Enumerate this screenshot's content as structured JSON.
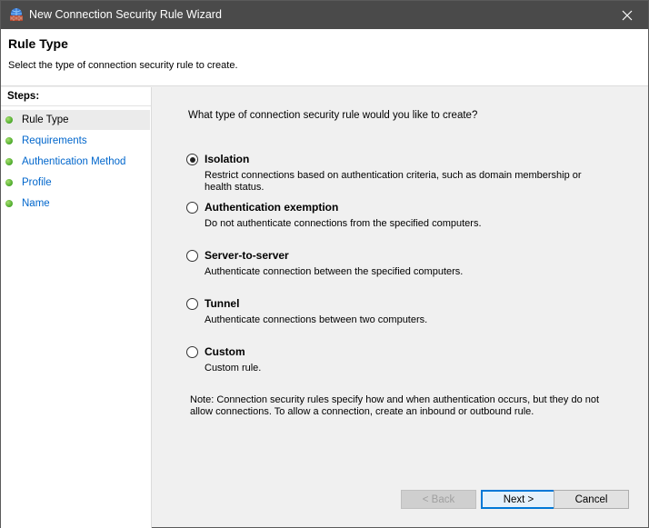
{
  "window": {
    "title": "New Connection Security Rule Wizard"
  },
  "header": {
    "title": "Rule Type",
    "subtitle": "Select the type of connection security rule to create."
  },
  "sidebar": {
    "title": "Steps:",
    "items": [
      {
        "label": "Rule Type",
        "current": true
      },
      {
        "label": "Requirements",
        "current": false
      },
      {
        "label": "Authentication Method",
        "current": false
      },
      {
        "label": "Profile",
        "current": false
      },
      {
        "label": "Name",
        "current": false
      }
    ]
  },
  "main": {
    "question": "What type of connection security rule would you like to create?",
    "options": [
      {
        "label": "Isolation",
        "description": "Restrict connections based on authentication criteria, such as domain membership or health status.",
        "selected": true
      },
      {
        "label": "Authentication exemption",
        "description": "Do not authenticate connections from the specified computers.",
        "selected": false
      },
      {
        "label": "Server-to-server",
        "description": "Authenticate connection between the specified computers.",
        "selected": false
      },
      {
        "label": "Tunnel",
        "description": "Authenticate connections between two computers.",
        "selected": false
      },
      {
        "label": "Custom",
        "description": "Custom rule.",
        "selected": false
      }
    ],
    "note": "Note:  Connection security rules specify how and when authentication occurs, but they do not allow connections.  To allow a connection, create an inbound or outbound rule."
  },
  "buttons": {
    "back": "< Back",
    "next": "Next >",
    "cancel": "Cancel"
  },
  "colors": {
    "titlebar": "#4a4a4a",
    "link": "#0066cc",
    "step_dot": "#4aa82a",
    "accent": "#0078d7"
  }
}
